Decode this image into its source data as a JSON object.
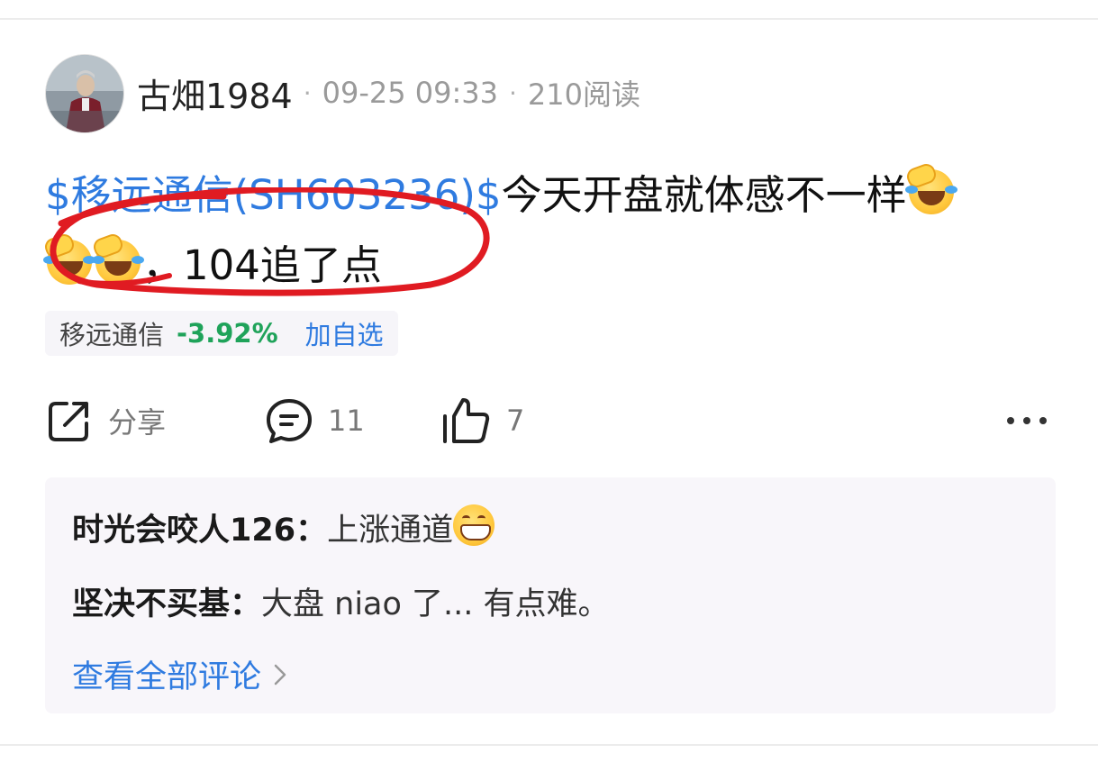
{
  "post": {
    "author": "古畑1984",
    "date": "09-25 09:33",
    "reads": "210阅读",
    "separator": "·",
    "stock_tag": "$移远通信(SH603236)$",
    "text_part1": "今天开盘就体感不一样",
    "text_part2": "，104追了点"
  },
  "stock_chip": {
    "name": "移远通信",
    "change": "-3.92%",
    "add_label": "加自选",
    "change_color": "#1fa35a"
  },
  "actions": {
    "share_label": "分享",
    "comment_count": "11",
    "like_count": "7"
  },
  "comments": [
    {
      "author": "时光会咬人126：",
      "text": "上涨通道"
    },
    {
      "author": "坚决不买基：",
      "text": "大盘 niao 了... 有点难。"
    }
  ],
  "view_all_label": "查看全部评论",
  "colors": {
    "link": "#2f7be0",
    "annotation": "#e01b22"
  },
  "icons": [
    "share-icon",
    "comment-icon",
    "thumbs-up-icon",
    "more-icon",
    "chevron-right-icon",
    "laughing-crying-emoji",
    "grinning-emoji"
  ]
}
